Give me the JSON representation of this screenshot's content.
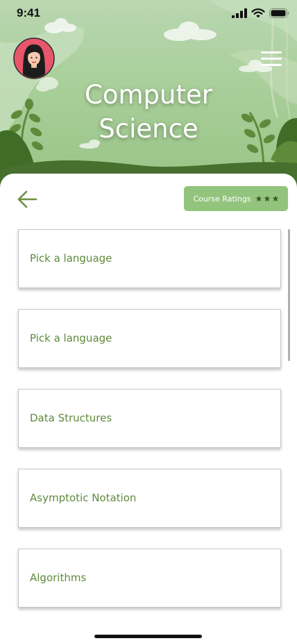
{
  "status_bar": {
    "time": "9:41",
    "icons": [
      "cellular-signal-icon",
      "wifi-icon",
      "battery-icon"
    ]
  },
  "header": {
    "title_line1": "Computer",
    "title_line2": "Science",
    "avatar": "avatar",
    "menu_icon": "hamburger-menu-icon"
  },
  "toolbar": {
    "back_icon": "arrow-left-icon",
    "ratings_label": "Course Ratings",
    "rating_stars": 3
  },
  "courses": [
    {
      "label": "Pick a language"
    },
    {
      "label": "Pick a language"
    },
    {
      "label": "Data Structures"
    },
    {
      "label": "Asymptotic Notation"
    },
    {
      "label": "Algorithms"
    }
  ],
  "colors": {
    "accent": "#93c47d",
    "course_text": "#5e8a3c",
    "back_arrow": "#6b8f3f"
  }
}
